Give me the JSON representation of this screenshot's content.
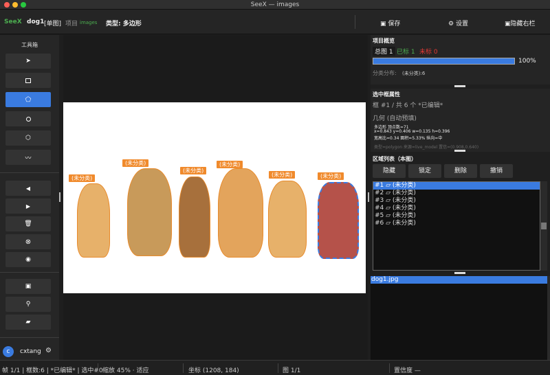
{
  "window": {
    "title": "SeeX — images"
  },
  "toolbar": {
    "app": "SeeX",
    "file": "dog1",
    "mode": "[单图]",
    "project_label": "项目",
    "project": "images",
    "type": "类型: 多边形",
    "save": "保存",
    "settings": "设置",
    "hide_right": "隐藏右栏"
  },
  "tools": {
    "title": "工具箱"
  },
  "user": {
    "initial": "c",
    "name": "cxtang"
  },
  "labels": [
    "(未分类)",
    "(未分类)",
    "(未分类)",
    "(未分类)",
    "(未分类)",
    "(未分类)"
  ],
  "overview": {
    "title": "项目概览",
    "total": "总图 1",
    "done": "已标 1",
    "todo": "未标 0",
    "progress": 1.0,
    "percent": "100%",
    "dist": "分类分布:",
    "dist_val": "(未分类):6"
  },
  "selected": {
    "title": "选中框属性",
    "index": "框 #1 / 共 6 个  *已编辑*",
    "geom": "几何 (自动预填)",
    "l1": "多边形 顶点数=71",
    "l2": "x=0.843 y=0.406 w=0.135 h=0.396",
    "l3": "宽高比=0.34  面积=5.33%  纵向=中",
    "meta": "类型=polygon 来源=live_model 置信=(0.908,0.640)"
  },
  "regions": {
    "title": "区域列表（本图）",
    "hide": "隐藏",
    "lock": "锁定",
    "delete": "删除",
    "undo": "撤销",
    "items": [
      "#1 ▱ (未分类)",
      "#2 ▱ (未分类)",
      "#3 ▱ (未分类)",
      "#4 ▱ (未分类)",
      "#5 ▱ (未分类)",
      "#6 ▱ (未分类)"
    ]
  },
  "files": [
    "dog1.jpg"
  ],
  "status": {
    "frame": "帧 1/1 | 框数:6 | *已编辑* | 选中#0",
    "zoom": "缩放 45% · 适应",
    "coord": "坐标 (1208, 184)",
    "image": "图 1/1",
    "conf": "置信度 —"
  }
}
